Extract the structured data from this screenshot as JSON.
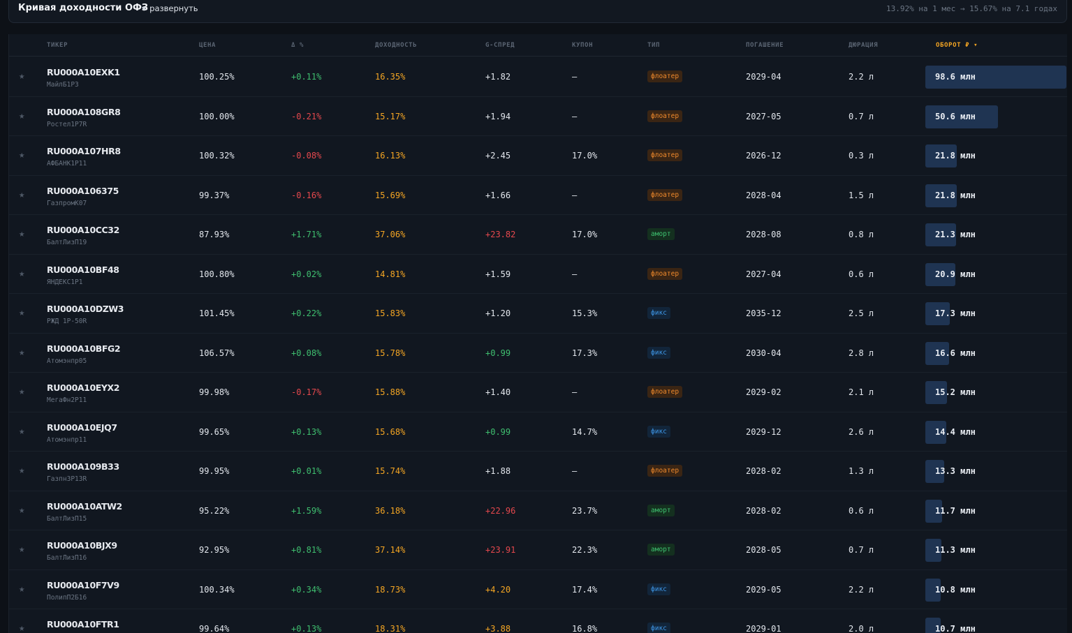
{
  "header": {
    "title": "Кривая доходности ОФЗ",
    "expand_label": "развернуть",
    "summary": "13.92% на 1 мес → 15.67% на 7.1 годах"
  },
  "columns": {
    "ticker": "ТИКЕР",
    "price": "ЦЕНА",
    "change": "Δ %",
    "yield": "ДОХОДНОСТЬ",
    "gspread": "G-СПРЕД",
    "coupon": "КУПОН",
    "type": "ТИП",
    "maturity": "ПОГАШЕНИЕ",
    "duration": "ДЮРАЦИЯ",
    "turnover": "ОБОРОТ ₽ ▾"
  },
  "colors": {
    "accent": "#f5a623",
    "positive": "#3fbf6f",
    "negative": "#e5484d",
    "floater": "#f08a2c",
    "amort": "#3ec06f",
    "fix": "#3e97e8"
  },
  "rows": [
    {
      "ticker": "RU000A10EXK1",
      "issuer": "МайлБ1Р3",
      "price": "100.25%",
      "change": "+0.11%",
      "yield": "16.35%",
      "spread": "+1.82",
      "coupon": "—",
      "type": "флоатер",
      "maturity": "2029-04",
      "duration": "2.2 л",
      "turnover": "98.6 млн",
      "turnover_value": 98.6
    },
    {
      "ticker": "RU000A108GR8",
      "issuer": "Ростел1Р7R",
      "price": "100.00%",
      "change": "-0.21%",
      "yield": "15.17%",
      "spread": "+1.94",
      "coupon": "—",
      "type": "флоатер",
      "maturity": "2027-05",
      "duration": "0.7 л",
      "turnover": "50.6 млн",
      "turnover_value": 50.6
    },
    {
      "ticker": "RU000A107HR8",
      "issuer": "АФБАНК1Р11",
      "price": "100.32%",
      "change": "-0.08%",
      "yield": "16.13%",
      "spread": "+2.45",
      "coupon": "17.0%",
      "type": "флоатер",
      "maturity": "2026-12",
      "duration": "0.3 л",
      "turnover": "21.8 млн",
      "turnover_value": 21.8
    },
    {
      "ticker": "RU000A106375",
      "issuer": "ГазпромК07",
      "price": "99.37%",
      "change": "-0.16%",
      "yield": "15.69%",
      "spread": "+1.66",
      "coupon": "—",
      "type": "флоатер",
      "maturity": "2028-04",
      "duration": "1.5 л",
      "turnover": "21.8 млн",
      "turnover_value": 21.8
    },
    {
      "ticker": "RU000A10CC32",
      "issuer": "БалтЛизП19",
      "price": "87.93%",
      "change": "+1.71%",
      "yield": "37.06%",
      "spread": "+23.82",
      "coupon": "17.0%",
      "type": "аморт",
      "maturity": "2028-08",
      "duration": "0.8 л",
      "turnover": "21.3 млн",
      "turnover_value": 21.3
    },
    {
      "ticker": "RU000A10BF48",
      "issuer": "ЯНДЕКС1Р1",
      "price": "100.80%",
      "change": "+0.02%",
      "yield": "14.81%",
      "spread": "+1.59",
      "coupon": "—",
      "type": "флоатер",
      "maturity": "2027-04",
      "duration": "0.6 л",
      "turnover": "20.9 млн",
      "turnover_value": 20.9
    },
    {
      "ticker": "RU000A10DZW3",
      "issuer": "РЖД 1Р-50R",
      "price": "101.45%",
      "change": "+0.22%",
      "yield": "15.83%",
      "spread": "+1.20",
      "coupon": "15.3%",
      "type": "фикс",
      "maturity": "2035-12",
      "duration": "2.5 л",
      "turnover": "17.3 млн",
      "turnover_value": 17.3
    },
    {
      "ticker": "RU000A10BFG2",
      "issuer": "Атомэнпр05",
      "price": "106.57%",
      "change": "+0.08%",
      "yield": "15.78%",
      "spread": "+0.99",
      "coupon": "17.3%",
      "type": "фикс",
      "maturity": "2030-04",
      "duration": "2.8 л",
      "turnover": "16.6 млн",
      "turnover_value": 16.6
    },
    {
      "ticker": "RU000A10EYX2",
      "issuer": "МегаФн2Р11",
      "price": "99.98%",
      "change": "-0.17%",
      "yield": "15.88%",
      "spread": "+1.40",
      "coupon": "—",
      "type": "флоатер",
      "maturity": "2029-02",
      "duration": "2.1 л",
      "turnover": "15.2 млн",
      "turnover_value": 15.2
    },
    {
      "ticker": "RU000A10EJQ7",
      "issuer": "Атомэнпр11",
      "price": "99.65%",
      "change": "+0.13%",
      "yield": "15.68%",
      "spread": "+0.99",
      "coupon": "14.7%",
      "type": "фикс",
      "maturity": "2029-12",
      "duration": "2.6 л",
      "turnover": "14.4 млн",
      "turnover_value": 14.4
    },
    {
      "ticker": "RU000A109B33",
      "issuer": "ГазпнЗР13R",
      "price": "99.95%",
      "change": "+0.01%",
      "yield": "15.74%",
      "spread": "+1.88",
      "coupon": "—",
      "type": "флоатер",
      "maturity": "2028-02",
      "duration": "1.3 л",
      "turnover": "13.3 млн",
      "turnover_value": 13.3
    },
    {
      "ticker": "RU000A10ATW2",
      "issuer": "БалтЛизП15",
      "price": "95.22%",
      "change": "+1.59%",
      "yield": "36.18%",
      "spread": "+22.96",
      "coupon": "23.7%",
      "type": "аморт",
      "maturity": "2028-02",
      "duration": "0.6 л",
      "turnover": "11.7 млн",
      "turnover_value": 11.7
    },
    {
      "ticker": "RU000A10BJX9",
      "issuer": "БалтЛизП16",
      "price": "92.95%",
      "change": "+0.81%",
      "yield": "37.14%",
      "spread": "+23.91",
      "coupon": "22.3%",
      "type": "аморт",
      "maturity": "2028-05",
      "duration": "0.7 л",
      "turnover": "11.3 млн",
      "turnover_value": 11.3
    },
    {
      "ticker": "RU000A10F7V9",
      "issuer": "ПолипП2Б16",
      "price": "100.34%",
      "change": "+0.34%",
      "yield": "18.73%",
      "spread": "+4.20",
      "coupon": "17.4%",
      "type": "фикс",
      "maturity": "2029-05",
      "duration": "2.2 л",
      "turnover": "10.8 млн",
      "turnover_value": 10.8
    },
    {
      "ticker": "RU000A10FTR1",
      "issuer": "",
      "price": "99.64%",
      "change": "+0.13%",
      "yield": "18.31%",
      "spread": "+3.88",
      "coupon": "16.8%",
      "type": "фикс",
      "maturity": "2029-01",
      "duration": "2.0 л",
      "turnover": "10.7 млн",
      "turnover_value": 10.7
    }
  ]
}
